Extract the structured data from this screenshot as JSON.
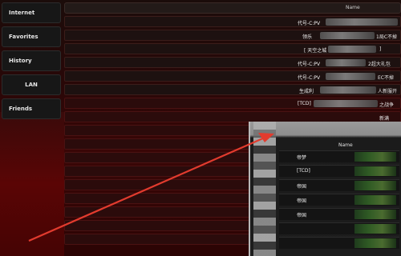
{
  "sidebar": {
    "items": [
      {
        "label": "Internet"
      },
      {
        "label": "Favorites"
      },
      {
        "label": "History"
      },
      {
        "label": "LAN"
      },
      {
        "label": "Friends"
      }
    ]
  },
  "server_list": {
    "column_header": "Name",
    "rows": [
      {
        "name": "代号-C:PV",
        "tail": ""
      },
      {
        "name": "领乐",
        "tail": "1局C不掉"
      },
      {
        "name": "[ 天空之城",
        "tail": "]"
      },
      {
        "name": "代号-C:PV",
        "tail": "2超大礼包"
      },
      {
        "name": "代号-C:PV",
        "tail": "EC不掉"
      },
      {
        "name": "生成利",
        "tail": "人新服开"
      },
      {
        "name": "[TCD]",
        "tail": "之战争"
      },
      {
        "name": "",
        "tail": "新满"
      },
      {
        "name": "",
        "tail": ""
      },
      {
        "name": "",
        "tail": ""
      },
      {
        "name": "",
        "tail": ""
      },
      {
        "name": "",
        "tail": ""
      },
      {
        "name": "",
        "tail": ""
      },
      {
        "name": "",
        "tail": ""
      },
      {
        "name": "",
        "tail": ""
      },
      {
        "name": "",
        "tail": ""
      },
      {
        "name": "",
        "tail": ""
      }
    ]
  },
  "overlay": {
    "column_header": "Name",
    "rows": [
      {
        "name": "帝梦"
      },
      {
        "name": "[TCD]"
      },
      {
        "name": "帝国"
      },
      {
        "name": "帝国"
      },
      {
        "name": "帝国"
      }
    ]
  },
  "colors": {
    "arrow": "#e23b2e",
    "background": "#2a0707"
  }
}
